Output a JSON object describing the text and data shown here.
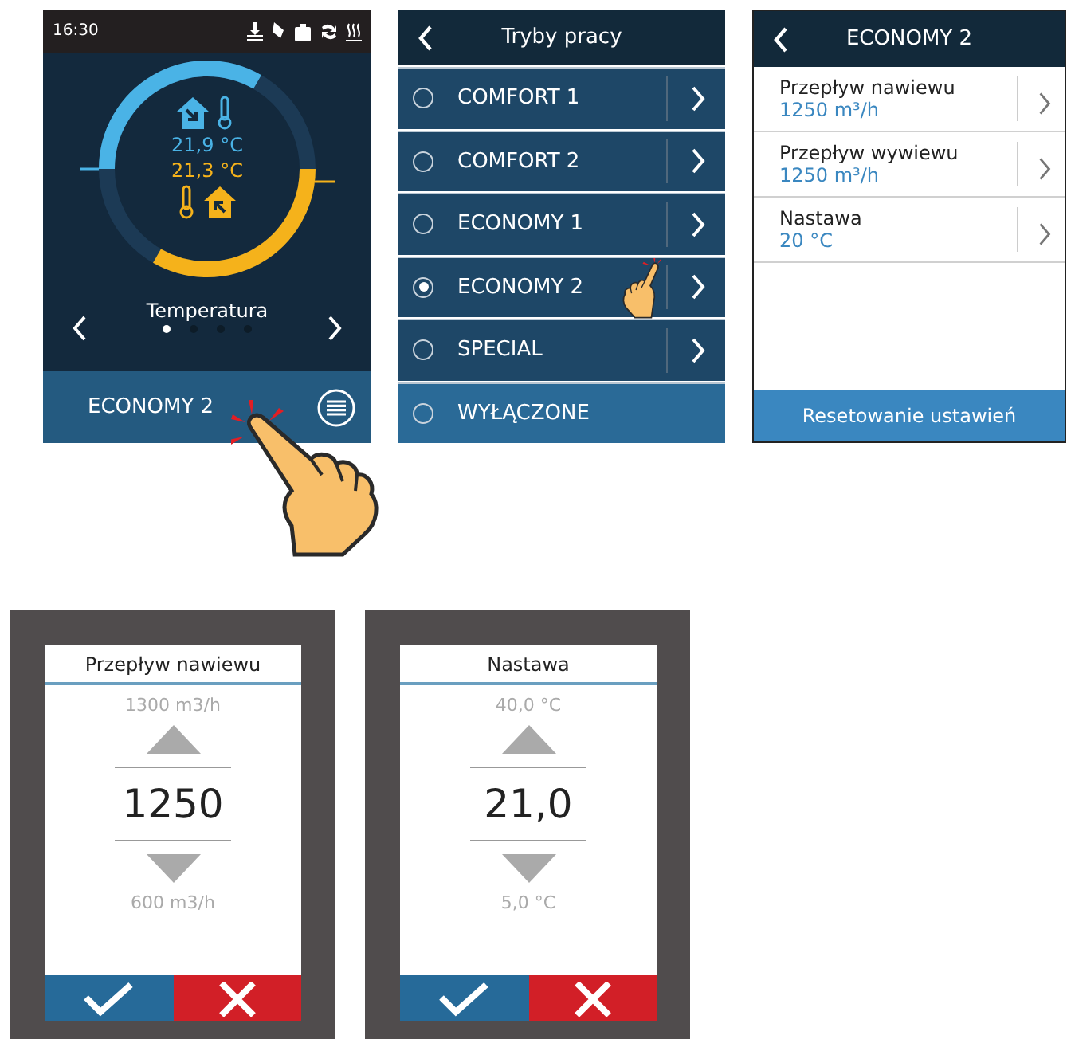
{
  "home_screen": {
    "time": "16:30",
    "supply_temperature": "21,9 °C",
    "extract_temperature": "21,3 °C",
    "page_title": "Temperatura",
    "pages": [
      {
        "selected": true
      },
      {
        "selected": false
      },
      {
        "selected": false
      },
      {
        "selected": false
      }
    ],
    "mode": "ECONOMY 2"
  },
  "modes_screen": {
    "title": "Tryby pracy",
    "items": [
      {
        "label": "COMFORT 1",
        "selected": false,
        "kind": "submenu"
      },
      {
        "label": "COMFORT 2",
        "selected": false,
        "kind": "submenu"
      },
      {
        "label": "ECONOMY 1",
        "selected": false,
        "kind": "submenu"
      },
      {
        "label": "ECONOMY 2",
        "selected": true,
        "kind": "submenu"
      },
      {
        "label": "SPECIAL",
        "selected": false,
        "kind": "submenu"
      },
      {
        "label": "WYŁĄCZONE",
        "selected": false,
        "kind": "plain"
      }
    ]
  },
  "settings_screen": {
    "title": "ECONOMY 2",
    "items": [
      {
        "label": "Przepływ nawiewu",
        "value": "1250 m³/h"
      },
      {
        "label": "Przepływ wywiewu",
        "value": "1250 m³/h"
      },
      {
        "label": "Nastawa",
        "value": "20 °C"
      }
    ],
    "reset_button": "Resetowanie ustawień"
  },
  "editors": [
    {
      "title": "Przepływ nawiewu",
      "max": "1300 m3/h",
      "value": "1250",
      "min": "600 m3/h"
    },
    {
      "title": "Nastawa",
      "max": "40,0 °C",
      "value": "21,0",
      "min": "5,0 °C"
    }
  ]
}
